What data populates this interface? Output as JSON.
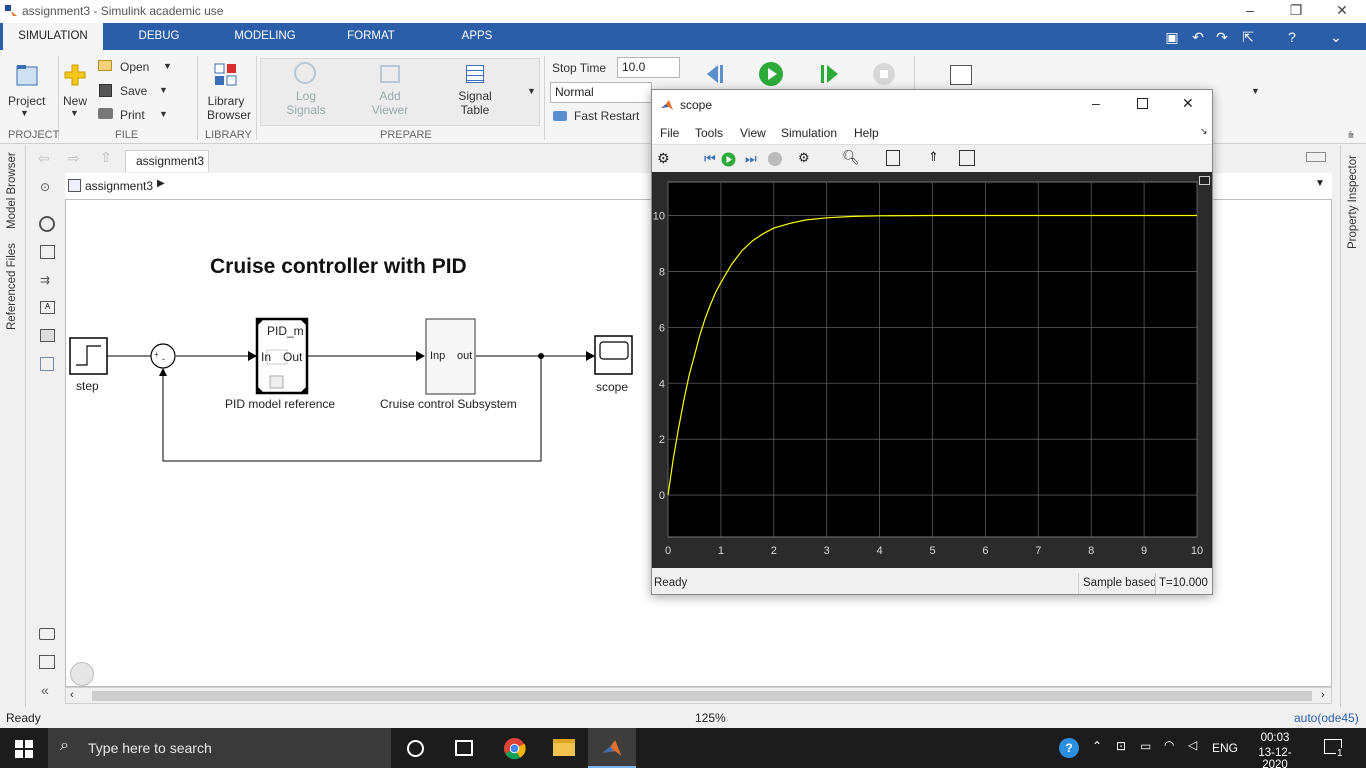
{
  "window": {
    "title": "assignment3 - Simulink academic use"
  },
  "tabs": [
    "SIMULATION",
    "DEBUG",
    "MODELING",
    "FORMAT",
    "APPS"
  ],
  "ribbon": {
    "project": "Project",
    "new": "New",
    "open": "Open",
    "save": "Save",
    "print": "Print",
    "library_browser_1": "Library",
    "library_browser_2": "Browser",
    "log_signals_1": "Log",
    "log_signals_2": "Signals",
    "add_viewer_1": "Add",
    "add_viewer_2": "Viewer",
    "signal_table_1": "Signal",
    "signal_table_2": "Table",
    "stop_time_label": "Stop Time",
    "stop_time_value": "10.0",
    "sim_mode": "Normal",
    "fast_restart": "Fast Restart",
    "sections": {
      "project": "PROJECT",
      "file": "FILE",
      "library": "LIBRARY",
      "prepare": "PREPARE"
    }
  },
  "model": {
    "tab": "assignment3",
    "breadcrumb": "assignment3",
    "title": "Cruise controller with PID",
    "blocks": {
      "step": "step",
      "pid_top": "PID_m",
      "pid_in": "In",
      "pid_out": "Out",
      "pid_caption": "PID model reference",
      "sub_in": "Inp",
      "sub_out": "out",
      "sub_caption": "Cruise control Subsystem",
      "scope": "scope",
      "sum_plus": "+",
      "sum_minus": "-"
    }
  },
  "side": {
    "model_browser": "Model Browser",
    "referenced_files": "Referenced Files",
    "property_inspector": "Property Inspector"
  },
  "status": {
    "left": "Ready",
    "zoom": "125%",
    "solver": "auto(ode45)"
  },
  "scope": {
    "title": "scope",
    "menu": [
      "File",
      "Tools",
      "View",
      "Simulation",
      "Help"
    ],
    "status_left": "Ready",
    "status_mid": "Sample based",
    "status_right": "T=10.000"
  },
  "chart_data": {
    "type": "line",
    "title": "",
    "xlabel": "",
    "ylabel": "",
    "xlim": [
      0,
      10
    ],
    "ylim": [
      -1.5,
      11.2
    ],
    "xticks": [
      0,
      1,
      2,
      3,
      4,
      5,
      6,
      7,
      8,
      9,
      10
    ],
    "yticks": [
      0,
      2,
      4,
      6,
      8,
      10
    ],
    "grid": true,
    "line_color": "#ffff00",
    "background": "#000000",
    "series": [
      {
        "x": [
          0,
          0.1,
          0.2,
          0.3,
          0.4,
          0.5,
          0.6,
          0.7,
          0.8,
          0.9,
          1.0,
          1.2,
          1.4,
          1.6,
          1.8,
          2.0,
          2.3,
          2.6,
          3.0,
          3.5,
          4.0,
          5.0,
          6.0,
          7.0,
          8.0,
          9.0,
          10.0
        ],
        "y": [
          0,
          1.3,
          2.4,
          3.4,
          4.3,
          5.0,
          5.7,
          6.3,
          6.8,
          7.25,
          7.6,
          8.25,
          8.75,
          9.1,
          9.35,
          9.55,
          9.72,
          9.84,
          9.92,
          9.97,
          9.99,
          10,
          10,
          10,
          10,
          10,
          10
        ]
      }
    ]
  },
  "taskbar": {
    "search": "Type here to search",
    "lang": "ENG",
    "time": "00:03",
    "date": "13-12-2020",
    "notif": "1"
  }
}
